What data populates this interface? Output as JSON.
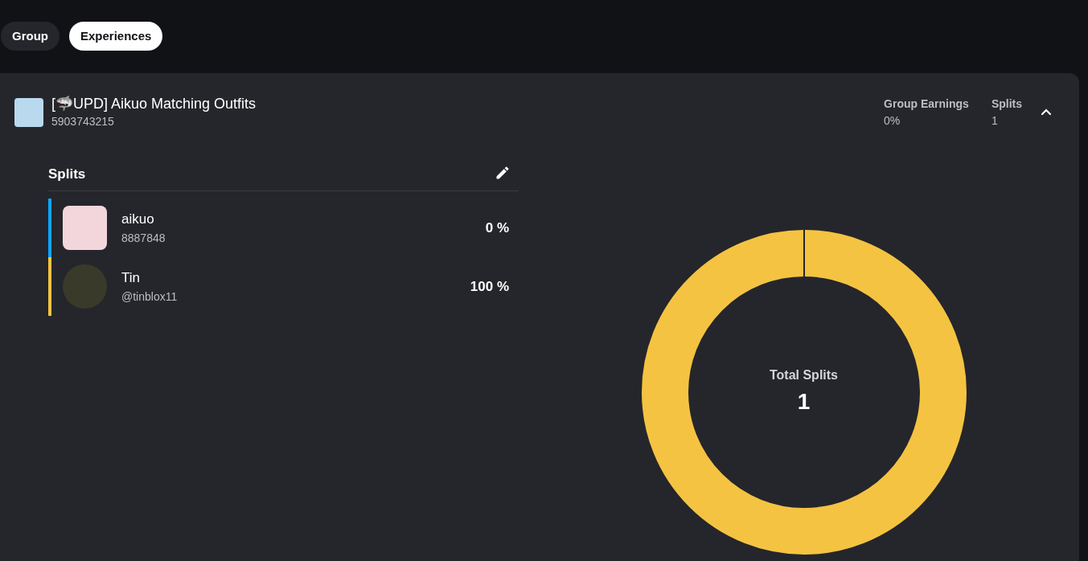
{
  "tabs": [
    {
      "label": "Group",
      "selected": false
    },
    {
      "label": "Experiences",
      "selected": true
    }
  ],
  "experience": {
    "title": "[🦈UPD] Aikuo Matching Outfits",
    "id": "5903743215",
    "expanded": true,
    "stats": [
      {
        "label": "Group Earnings",
        "value": "0%"
      },
      {
        "label": "Splits",
        "value": "1"
      }
    ]
  },
  "splits": {
    "title": "Splits",
    "members": [
      {
        "name": "aikuo",
        "handle": "8887848",
        "percent": "0 %",
        "color": "#0ea5ff",
        "kind": "square"
      },
      {
        "name": "Tin",
        "handle": "@tinblox11",
        "percent": "100 %",
        "color": "#f5c342",
        "kind": "round"
      }
    ],
    "center_label": "Total Splits",
    "center_value": "1"
  }
}
